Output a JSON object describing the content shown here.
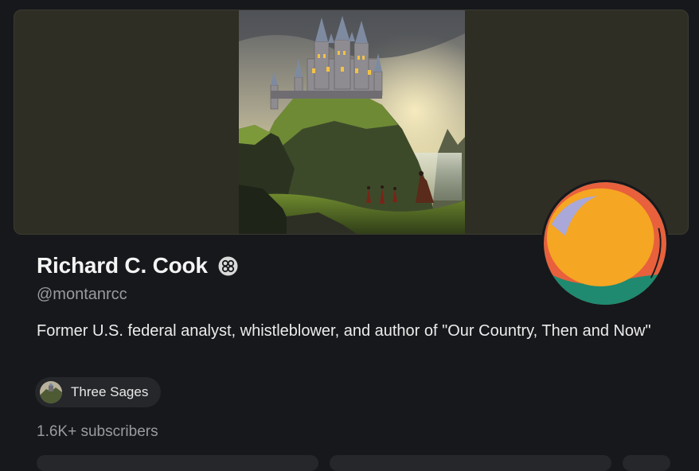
{
  "profile": {
    "name": "Richard C. Cook",
    "handle": "@montanrcc",
    "bio": "Former U.S. federal analyst, whistleblower, and author of \"Our Country, Then and Now\"",
    "subscribers": "1.6K+ subscribers",
    "badge_icon": "verified-badge-icon"
  },
  "publication": {
    "name": "Three Sages",
    "icon": "publication-thumbnail"
  },
  "colors": {
    "background": "#17181b",
    "banner": "#2e2e24",
    "chip": "#26272b",
    "muted_text": "#9a9b9e",
    "avatar_yellow": "#f5a623",
    "avatar_orange": "#e8603c",
    "avatar_teal": "#1f8a70",
    "avatar_lavender": "#a9a8d9"
  }
}
